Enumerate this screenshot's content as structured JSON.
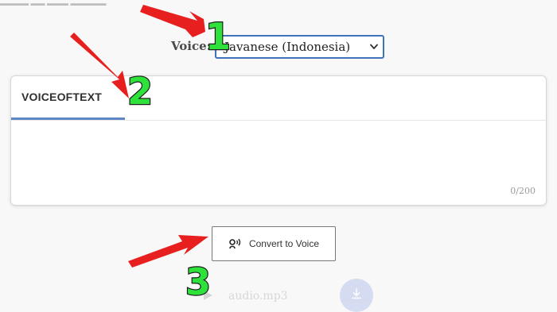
{
  "voice": {
    "label": "Voice:",
    "selected": "Javanese (Indonesia)"
  },
  "editor": {
    "tab_label": "VOICEOFTEXT",
    "char_count": "0/200"
  },
  "convert": {
    "label": "Convert to Voice"
  },
  "audio": {
    "file_name": "audio.mp3"
  },
  "annotations": {
    "step1": "1",
    "step2": "2",
    "step3": "3"
  },
  "colors": {
    "arrow": "#e81f1f",
    "step_number": "#2fe13b",
    "select_border": "#3e72b9",
    "tab_underline": "#5c86c4",
    "download_button": "#3b63d9"
  },
  "icons": {
    "select_chevron": "chevron-down-icon",
    "convert": "speaking-head-icon",
    "audio": "play-icon",
    "download": "download-icon"
  }
}
